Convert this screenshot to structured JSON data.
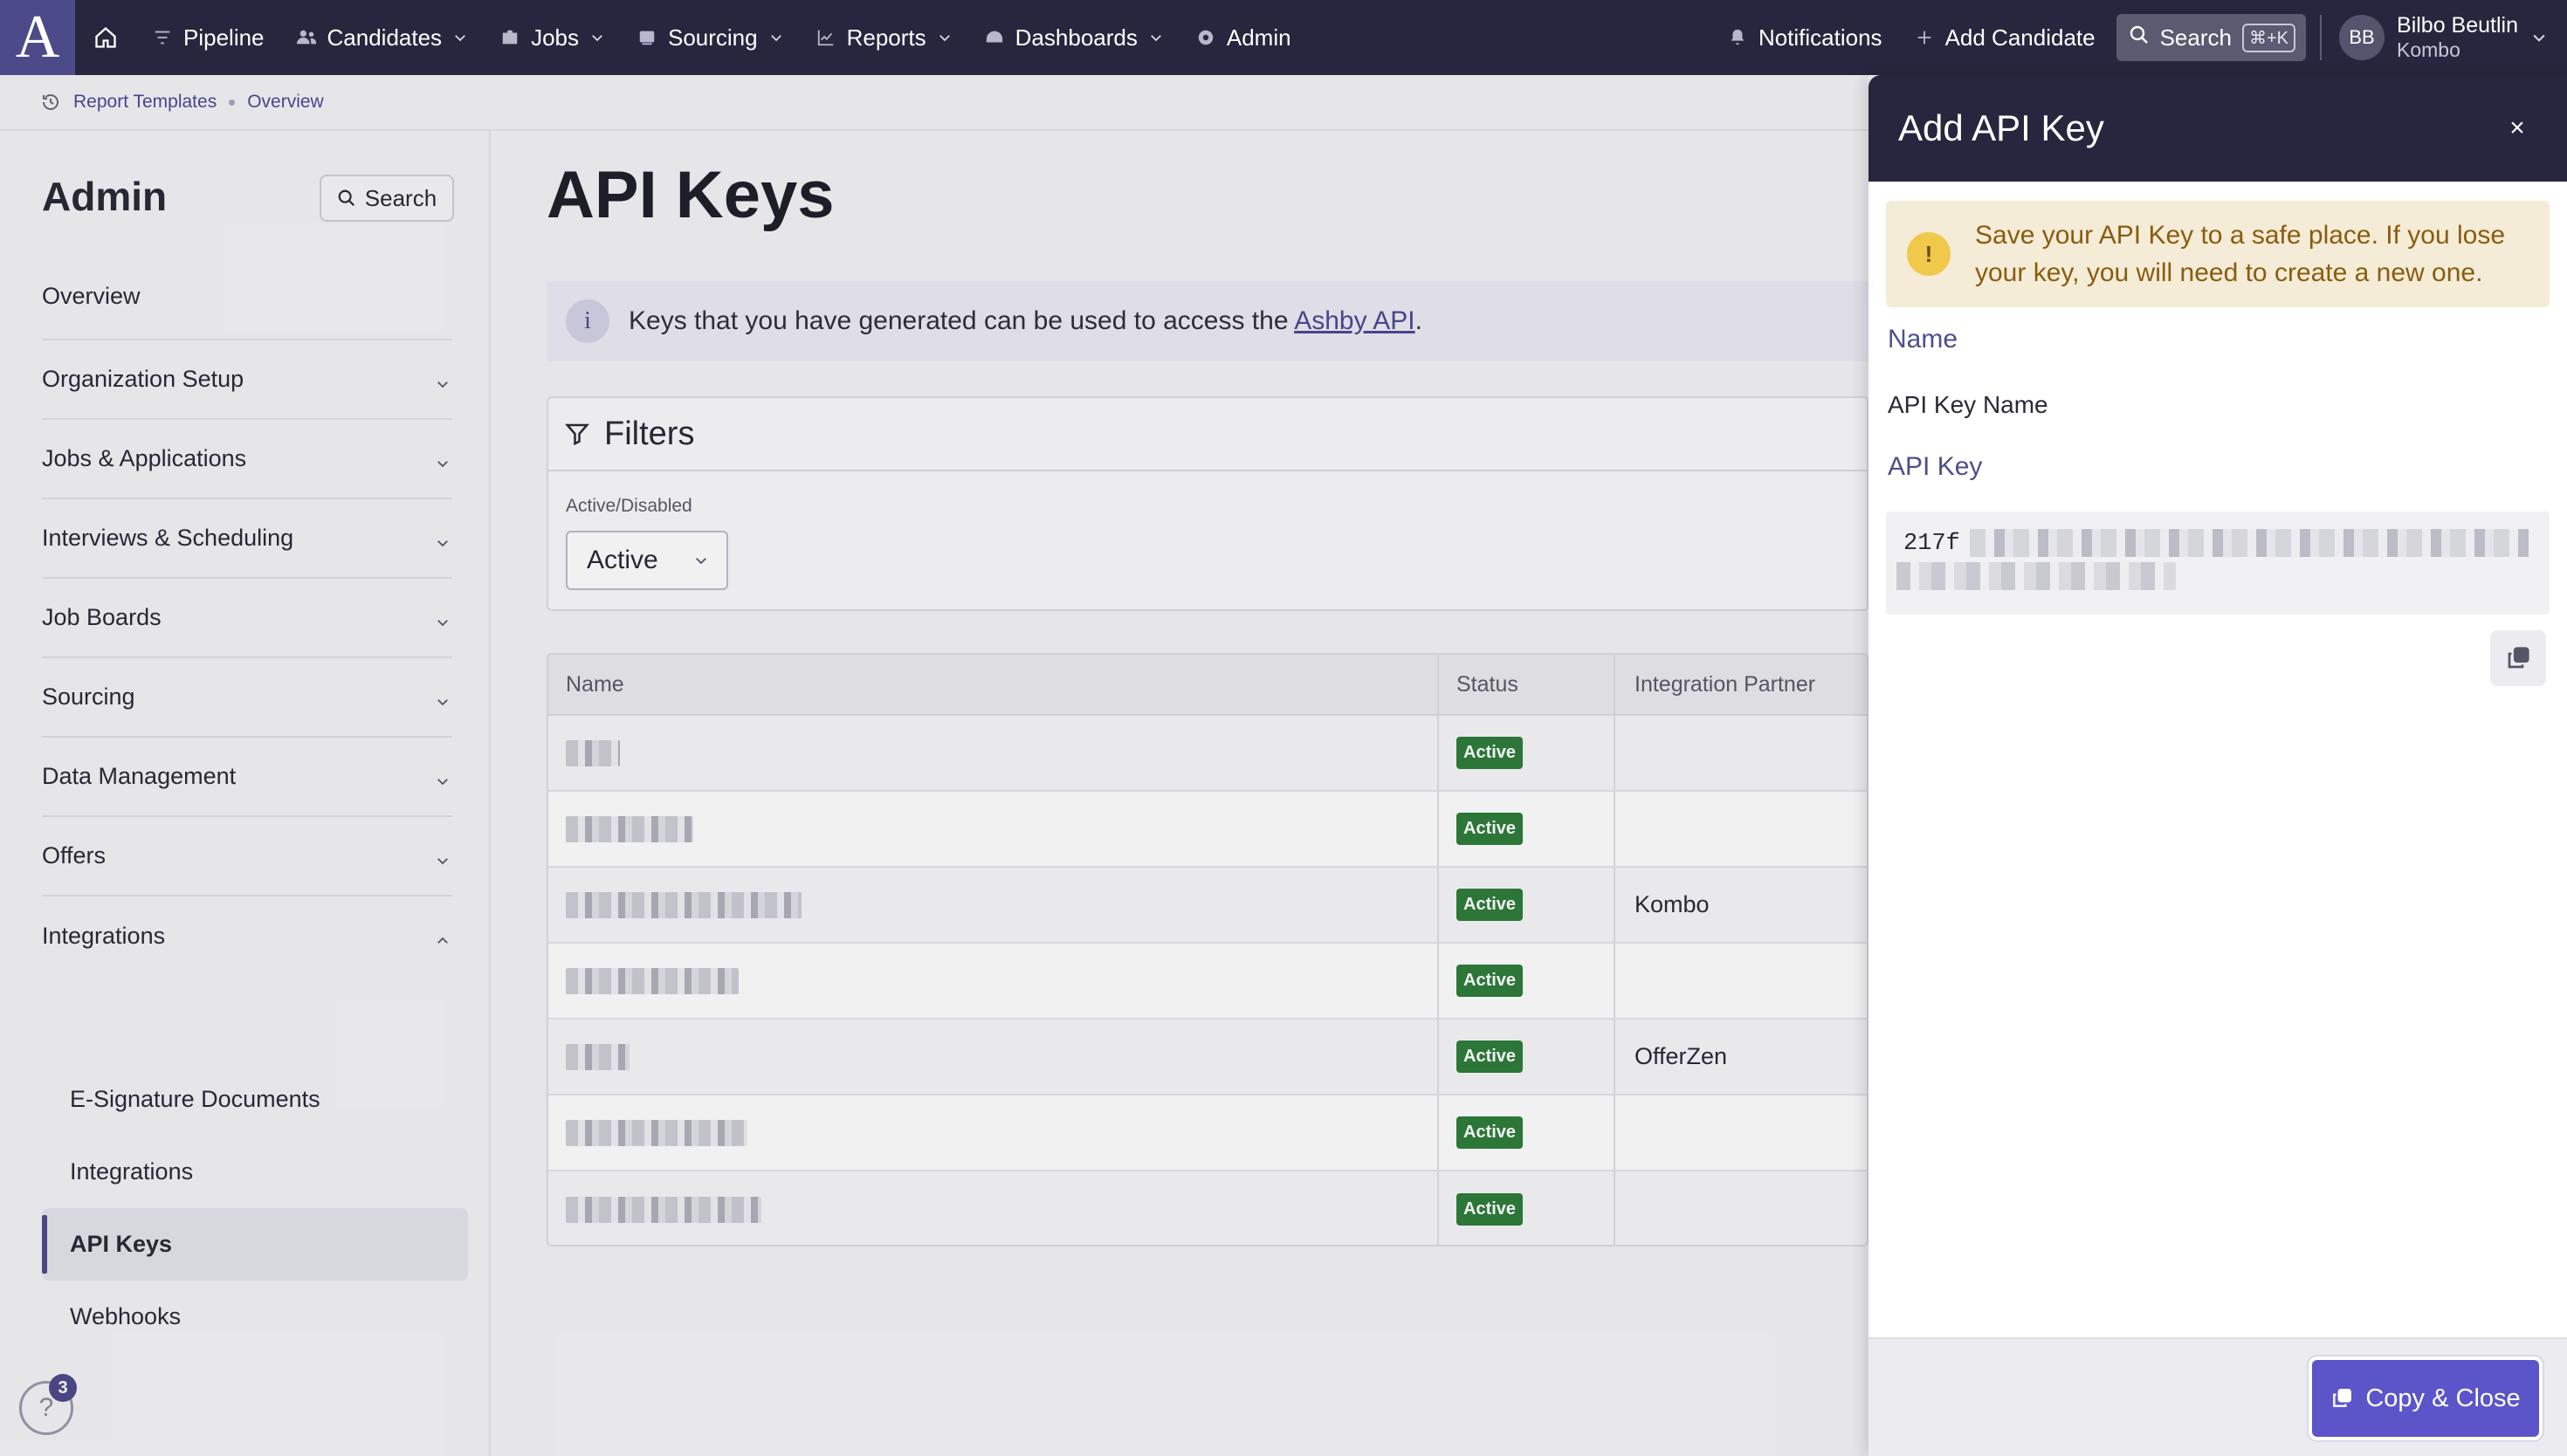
{
  "topnav": {
    "logo": "A",
    "items": [
      {
        "label": "Pipeline",
        "icon": "filter-icon",
        "chevron": false
      },
      {
        "label": "Candidates",
        "icon": "people-icon",
        "chevron": true
      },
      {
        "label": "Jobs",
        "icon": "briefcase-icon",
        "chevron": true
      },
      {
        "label": "Sourcing",
        "icon": "sourcing-icon",
        "chevron": true
      },
      {
        "label": "Reports",
        "icon": "chart-icon",
        "chevron": true
      },
      {
        "label": "Dashboards",
        "icon": "gauge-icon",
        "chevron": true
      },
      {
        "label": "Admin",
        "icon": "gear-icon",
        "chevron": false
      }
    ],
    "notifications": "Notifications",
    "add_candidate": "Add Candidate",
    "search": "Search",
    "search_shortcut": "⌘+K",
    "user_initials": "BB",
    "user_name": "Bilbo Beutlin",
    "user_org": "Kombo"
  },
  "breadcrumb": {
    "items": [
      "Report Templates",
      "Overview"
    ]
  },
  "sidebar": {
    "title": "Admin",
    "search_label": "Search",
    "items": [
      {
        "label": "Overview",
        "chevron": ""
      },
      {
        "label": "Organization Setup",
        "chevron": "down"
      },
      {
        "label": "Jobs & Applications",
        "chevron": "down"
      },
      {
        "label": "Interviews & Scheduling",
        "chevron": "down"
      },
      {
        "label": "Job Boards",
        "chevron": "down"
      },
      {
        "label": "Sourcing",
        "chevron": "down"
      },
      {
        "label": "Data Management",
        "chevron": "down"
      },
      {
        "label": "Offers",
        "chevron": "down"
      },
      {
        "label": "Integrations",
        "chevron": "up"
      }
    ],
    "sub_items": [
      {
        "label": "E-Signature Documents",
        "active": false
      },
      {
        "label": "Integrations",
        "active": false
      },
      {
        "label": "API Keys",
        "active": true
      },
      {
        "label": "Webhooks",
        "active": false
      }
    ],
    "help_badge": "3",
    "help_icon": "?"
  },
  "main": {
    "title": "API Keys",
    "info_text": "Keys that you have generated can be used to access the ",
    "info_link": "Ashby API",
    "info_suffix": ".",
    "filters_title": "Filters",
    "filter_label": "Active/Disabled",
    "filter_value": "Active",
    "table": {
      "headers": [
        "Name",
        "Status",
        "Integration Partner"
      ],
      "rows": [
        {
          "name_blur": 0.12,
          "status": "Active",
          "partner": ""
        },
        {
          "name_blur": 0.28,
          "status": "Active",
          "partner": ""
        },
        {
          "name_blur": 0.52,
          "status": "Active",
          "partner": "Kombo"
        },
        {
          "name_blur": 0.38,
          "status": "Active",
          "partner": ""
        },
        {
          "name_blur": 0.14,
          "status": "Active",
          "partner": "OfferZen"
        },
        {
          "name_blur": 0.4,
          "status": "Active",
          "partner": ""
        },
        {
          "name_blur": 0.43,
          "status": "Active",
          "partner": ""
        }
      ]
    }
  },
  "drawer": {
    "title": "Add API Key",
    "close": "×",
    "warning_icon": "!",
    "warning": "Save your API Key to a safe place. If you lose your key, you will need to create a new one.",
    "name_label": "Name",
    "name_value": "API Key Name",
    "key_label": "API Key",
    "key_prefix": "217f",
    "copy_close": "Copy & Close"
  },
  "colors": {
    "nav_bg": "#27263e",
    "accent": "#5b55c9",
    "active_badge": "#2e7d3a",
    "warning_bg": "#f5ecd7"
  }
}
